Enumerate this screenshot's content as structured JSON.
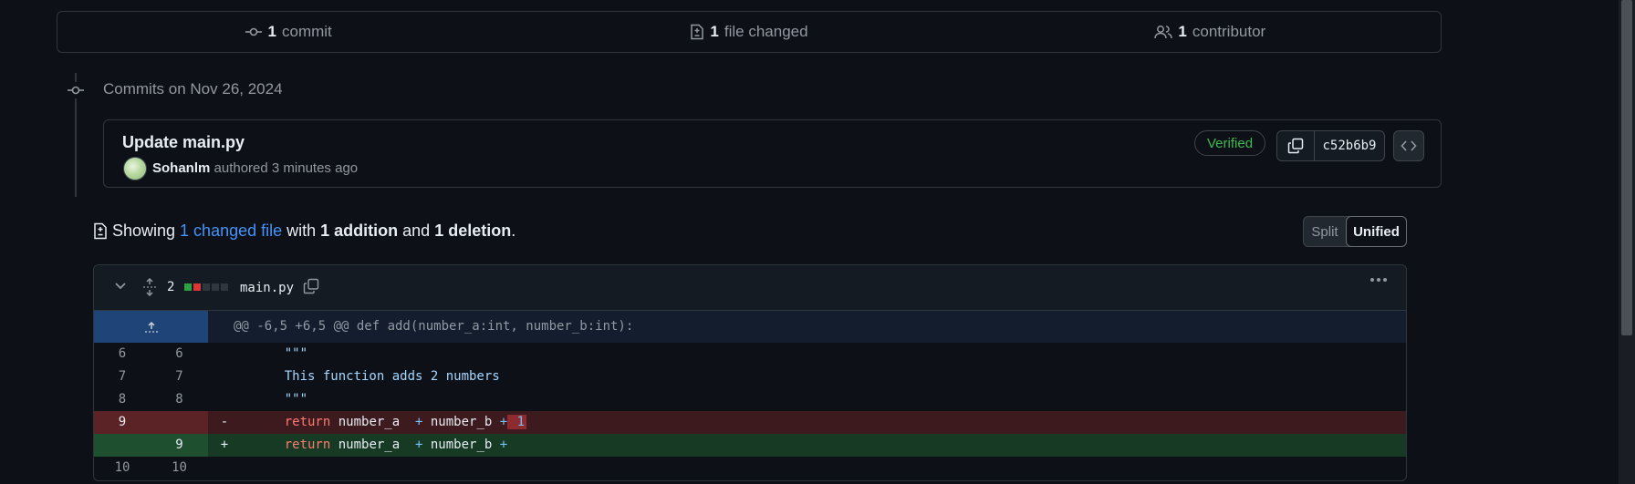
{
  "summary": {
    "commits_count": "1",
    "commits_label": "commit",
    "files_count": "1",
    "files_label": "file changed",
    "contributors_count": "1",
    "contributors_label": "contributor"
  },
  "timeline": {
    "date_label": "Commits on Nov 26, 2024"
  },
  "commit": {
    "title": "Update main.py",
    "author": "Sohanlm",
    "authored_text": "authored 3 minutes ago",
    "verified_label": "Verified",
    "sha": "c52b6b9"
  },
  "showing": {
    "prefix": "Showing",
    "changed_files_link": "1 changed file",
    "with": "with",
    "additions": "1 addition",
    "and": "and",
    "deletions": "1 deletion",
    "suffix": "."
  },
  "view_toggle": {
    "split_label": "Split",
    "unified_label": "Unified",
    "selected": "Unified"
  },
  "file": {
    "change_count": "2",
    "name": "main.py",
    "diffstat_colors": [
      "#2ea043",
      "#da3633",
      "#30363d",
      "#30363d",
      "#30363d"
    ]
  },
  "diff": {
    "hunk_header": "@@ -6,5 +6,5 @@ def add(number_a:int, number_b:int):",
    "lines": [
      {
        "old": "6",
        "new": "6",
        "marker": "",
        "code": "    \"\"\""
      },
      {
        "old": "7",
        "new": "7",
        "marker": "",
        "code": "    This function adds 2 numbers"
      },
      {
        "old": "8",
        "new": "8",
        "marker": "",
        "code": "    \"\"\""
      },
      {
        "old": "9",
        "new": "",
        "marker": "-",
        "code": "    return number_a  + number_b + 1"
      },
      {
        "old": "",
        "new": "9",
        "marker": "+",
        "code": "    return number_a  + number_b +"
      },
      {
        "old": "10",
        "new": "10",
        "marker": "",
        "code": ""
      }
    ]
  }
}
